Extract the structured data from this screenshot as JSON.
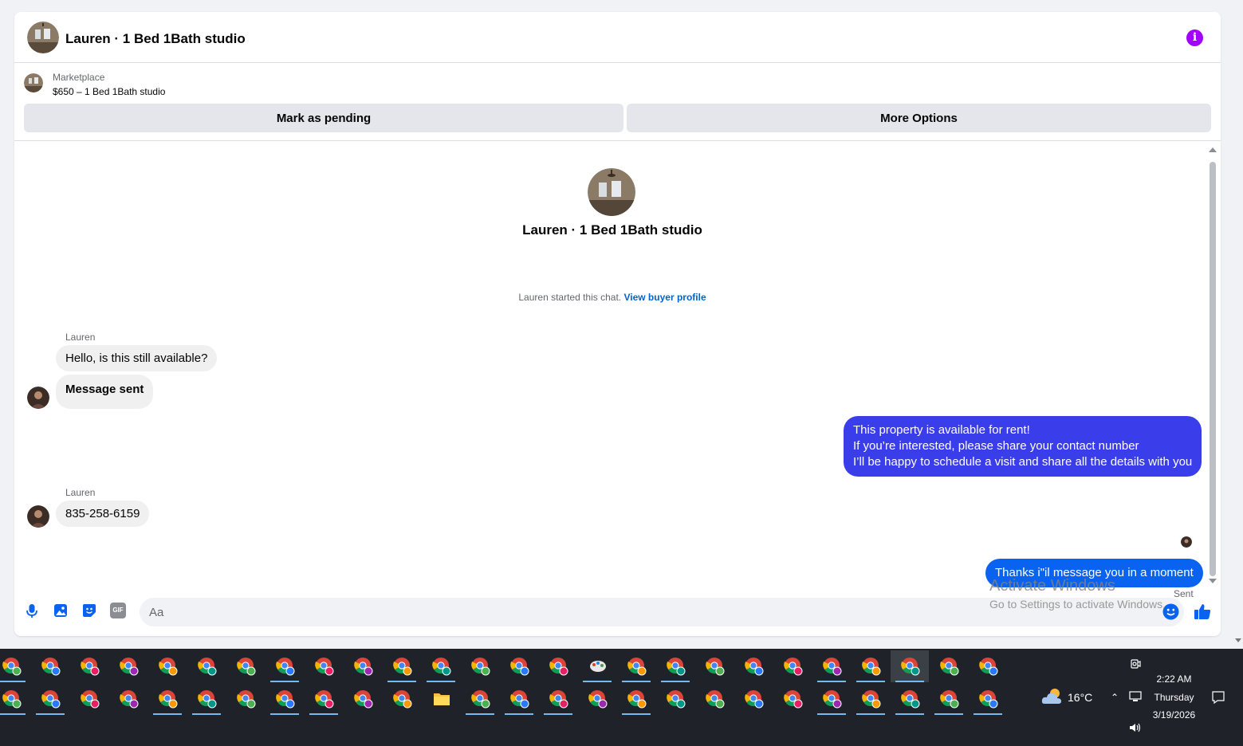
{
  "header": {
    "title": "Lauren · 1 Bed 1Bath studio",
    "info_icon": "i"
  },
  "listing": {
    "source": "Marketplace",
    "price_title": "$650 – 1 Bed 1Bath studio",
    "mark_pending_label": "Mark as pending",
    "more_options_label": "More Options"
  },
  "intro": {
    "name": "Lauren · 1 Bed 1Bath studio",
    "started_text": "Lauren started this chat.",
    "view_profile_link": "View buyer profile"
  },
  "messages": [
    {
      "sender": "Lauren",
      "text": "Hello, is this still available?"
    },
    {
      "text": "Message sent"
    },
    {
      "outgoing": true,
      "lines": [
        "This property is available for rent!",
        "If you’re interested, please share your contact number",
        "I’ll be happy to schedule a visit and share all the details with you"
      ]
    },
    {
      "sender": "Lauren",
      "text": "835-258-6159"
    },
    {
      "outgoing": true,
      "text": "Thanks i\"il message you in a moment",
      "status": "Sent"
    }
  ],
  "composer": {
    "placeholder": "Aa",
    "icons": [
      "microphone-icon",
      "photo-icon",
      "sticker-icon",
      "gif-icon",
      "emoji-icon",
      "thumbs-up-icon"
    ],
    "gif_label": "GIF"
  },
  "watermark": {
    "title": "Activate Windows",
    "subtitle": "Go to Settings to activate Windows."
  },
  "taskbar": {
    "weather_temp": "16°C",
    "time": "2:22 AM",
    "day": "Thursday",
    "date": "3/19/2026"
  },
  "colors": {
    "accent_purple": "#3a3dea",
    "accent_blue": "#0a63f0",
    "link_blue": "#0064d1",
    "info_purple": "#a200ff",
    "taskbar_bg": "#1f2329"
  }
}
